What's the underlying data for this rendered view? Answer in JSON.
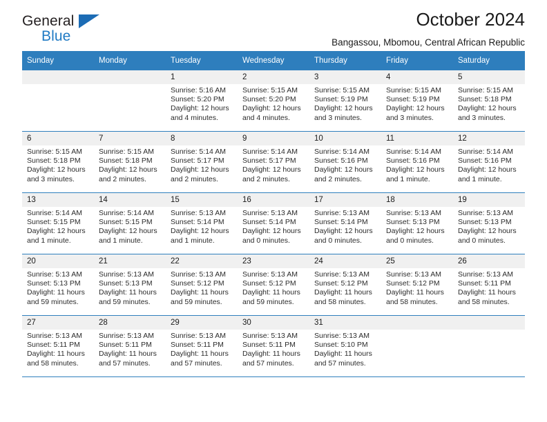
{
  "brand": {
    "name_part1": "General",
    "name_part2": "Blue",
    "triangle_color": "#1c6cb5",
    "blue_text_color": "#1f7ac4"
  },
  "header": {
    "title": "October 2024",
    "subtitle": "Bangassou, Mbomou, Central African Republic"
  },
  "theme": {
    "header_bar_color": "#2e7ebd",
    "daynum_band_color": "#f0f0f0",
    "row_border_color": "#2e7ebd"
  },
  "weekday_headers": [
    "Sunday",
    "Monday",
    "Tuesday",
    "Wednesday",
    "Thursday",
    "Friday",
    "Saturday"
  ],
  "labels": {
    "sunrise_prefix": "Sunrise:",
    "sunset_prefix": "Sunset:",
    "daylight_prefix": "Daylight:"
  },
  "weeks": [
    [
      {
        "day": "",
        "sunrise": "",
        "sunset": "",
        "daylight": ""
      },
      {
        "day": "",
        "sunrise": "",
        "sunset": "",
        "daylight": ""
      },
      {
        "day": "1",
        "sunrise": "Sunrise: 5:16 AM",
        "sunset": "Sunset: 5:20 PM",
        "daylight": "Daylight: 12 hours and 4 minutes."
      },
      {
        "day": "2",
        "sunrise": "Sunrise: 5:15 AM",
        "sunset": "Sunset: 5:20 PM",
        "daylight": "Daylight: 12 hours and 4 minutes."
      },
      {
        "day": "3",
        "sunrise": "Sunrise: 5:15 AM",
        "sunset": "Sunset: 5:19 PM",
        "daylight": "Daylight: 12 hours and 3 minutes."
      },
      {
        "day": "4",
        "sunrise": "Sunrise: 5:15 AM",
        "sunset": "Sunset: 5:19 PM",
        "daylight": "Daylight: 12 hours and 3 minutes."
      },
      {
        "day": "5",
        "sunrise": "Sunrise: 5:15 AM",
        "sunset": "Sunset: 5:18 PM",
        "daylight": "Daylight: 12 hours and 3 minutes."
      }
    ],
    [
      {
        "day": "6",
        "sunrise": "Sunrise: 5:15 AM",
        "sunset": "Sunset: 5:18 PM",
        "daylight": "Daylight: 12 hours and 3 minutes."
      },
      {
        "day": "7",
        "sunrise": "Sunrise: 5:15 AM",
        "sunset": "Sunset: 5:18 PM",
        "daylight": "Daylight: 12 hours and 2 minutes."
      },
      {
        "day": "8",
        "sunrise": "Sunrise: 5:14 AM",
        "sunset": "Sunset: 5:17 PM",
        "daylight": "Daylight: 12 hours and 2 minutes."
      },
      {
        "day": "9",
        "sunrise": "Sunrise: 5:14 AM",
        "sunset": "Sunset: 5:17 PM",
        "daylight": "Daylight: 12 hours and 2 minutes."
      },
      {
        "day": "10",
        "sunrise": "Sunrise: 5:14 AM",
        "sunset": "Sunset: 5:16 PM",
        "daylight": "Daylight: 12 hours and 2 minutes."
      },
      {
        "day": "11",
        "sunrise": "Sunrise: 5:14 AM",
        "sunset": "Sunset: 5:16 PM",
        "daylight": "Daylight: 12 hours and 1 minute."
      },
      {
        "day": "12",
        "sunrise": "Sunrise: 5:14 AM",
        "sunset": "Sunset: 5:16 PM",
        "daylight": "Daylight: 12 hours and 1 minute."
      }
    ],
    [
      {
        "day": "13",
        "sunrise": "Sunrise: 5:14 AM",
        "sunset": "Sunset: 5:15 PM",
        "daylight": "Daylight: 12 hours and 1 minute."
      },
      {
        "day": "14",
        "sunrise": "Sunrise: 5:14 AM",
        "sunset": "Sunset: 5:15 PM",
        "daylight": "Daylight: 12 hours and 1 minute."
      },
      {
        "day": "15",
        "sunrise": "Sunrise: 5:13 AM",
        "sunset": "Sunset: 5:14 PM",
        "daylight": "Daylight: 12 hours and 1 minute."
      },
      {
        "day": "16",
        "sunrise": "Sunrise: 5:13 AM",
        "sunset": "Sunset: 5:14 PM",
        "daylight": "Daylight: 12 hours and 0 minutes."
      },
      {
        "day": "17",
        "sunrise": "Sunrise: 5:13 AM",
        "sunset": "Sunset: 5:14 PM",
        "daylight": "Daylight: 12 hours and 0 minutes."
      },
      {
        "day": "18",
        "sunrise": "Sunrise: 5:13 AM",
        "sunset": "Sunset: 5:13 PM",
        "daylight": "Daylight: 12 hours and 0 minutes."
      },
      {
        "day": "19",
        "sunrise": "Sunrise: 5:13 AM",
        "sunset": "Sunset: 5:13 PM",
        "daylight": "Daylight: 12 hours and 0 minutes."
      }
    ],
    [
      {
        "day": "20",
        "sunrise": "Sunrise: 5:13 AM",
        "sunset": "Sunset: 5:13 PM",
        "daylight": "Daylight: 11 hours and 59 minutes."
      },
      {
        "day": "21",
        "sunrise": "Sunrise: 5:13 AM",
        "sunset": "Sunset: 5:13 PM",
        "daylight": "Daylight: 11 hours and 59 minutes."
      },
      {
        "day": "22",
        "sunrise": "Sunrise: 5:13 AM",
        "sunset": "Sunset: 5:12 PM",
        "daylight": "Daylight: 11 hours and 59 minutes."
      },
      {
        "day": "23",
        "sunrise": "Sunrise: 5:13 AM",
        "sunset": "Sunset: 5:12 PM",
        "daylight": "Daylight: 11 hours and 59 minutes."
      },
      {
        "day": "24",
        "sunrise": "Sunrise: 5:13 AM",
        "sunset": "Sunset: 5:12 PM",
        "daylight": "Daylight: 11 hours and 58 minutes."
      },
      {
        "day": "25",
        "sunrise": "Sunrise: 5:13 AM",
        "sunset": "Sunset: 5:12 PM",
        "daylight": "Daylight: 11 hours and 58 minutes."
      },
      {
        "day": "26",
        "sunrise": "Sunrise: 5:13 AM",
        "sunset": "Sunset: 5:11 PM",
        "daylight": "Daylight: 11 hours and 58 minutes."
      }
    ],
    [
      {
        "day": "27",
        "sunrise": "Sunrise: 5:13 AM",
        "sunset": "Sunset: 5:11 PM",
        "daylight": "Daylight: 11 hours and 58 minutes."
      },
      {
        "day": "28",
        "sunrise": "Sunrise: 5:13 AM",
        "sunset": "Sunset: 5:11 PM",
        "daylight": "Daylight: 11 hours and 57 minutes."
      },
      {
        "day": "29",
        "sunrise": "Sunrise: 5:13 AM",
        "sunset": "Sunset: 5:11 PM",
        "daylight": "Daylight: 11 hours and 57 minutes."
      },
      {
        "day": "30",
        "sunrise": "Sunrise: 5:13 AM",
        "sunset": "Sunset: 5:11 PM",
        "daylight": "Daylight: 11 hours and 57 minutes."
      },
      {
        "day": "31",
        "sunrise": "Sunrise: 5:13 AM",
        "sunset": "Sunset: 5:10 PM",
        "daylight": "Daylight: 11 hours and 57 minutes."
      },
      {
        "day": "",
        "sunrise": "",
        "sunset": "",
        "daylight": ""
      },
      {
        "day": "",
        "sunrise": "",
        "sunset": "",
        "daylight": ""
      }
    ]
  ]
}
